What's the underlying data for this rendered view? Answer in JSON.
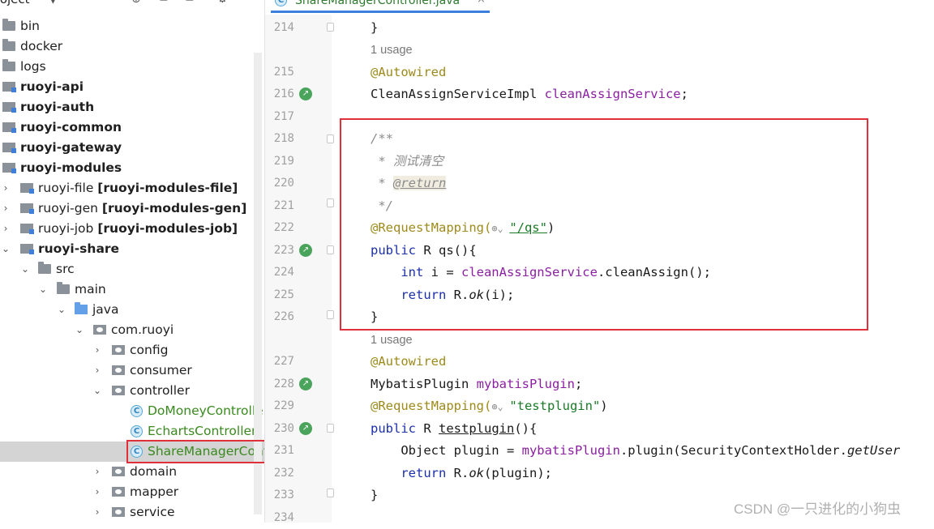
{
  "project_panel": {
    "title": "roject",
    "tree": [
      {
        "label": "bin",
        "bold": false
      },
      {
        "label": "docker",
        "bold": false
      },
      {
        "label": "logs",
        "bold": false
      },
      {
        "label": "ruoyi-api",
        "bold": true
      },
      {
        "label": "ruoyi-auth",
        "bold": true
      },
      {
        "label": "ruoyi-common",
        "bold": true
      },
      {
        "label": "ruoyi-gateway",
        "bold": true
      },
      {
        "label": "ruoyi-modules",
        "bold": true
      },
      {
        "label": "ruoyi-file",
        "suffix": "[ruoyi-modules-file]"
      },
      {
        "label": "ruoyi-gen",
        "suffix": "[ruoyi-modules-gen]"
      },
      {
        "label": "ruoyi-job",
        "suffix": "[ruoyi-modules-job]"
      },
      {
        "label": "ruoyi-share",
        "bold": true
      },
      {
        "label": "src"
      },
      {
        "label": "main"
      },
      {
        "label": "java"
      },
      {
        "label": "com.ruoyi"
      },
      {
        "label": "config"
      },
      {
        "label": "consumer"
      },
      {
        "label": "controller"
      },
      {
        "label": "DoMoneyController"
      },
      {
        "label": "EchartsController"
      },
      {
        "label": "ShareManagerController"
      },
      {
        "label": "domain"
      },
      {
        "label": "mapper"
      },
      {
        "label": "service"
      }
    ]
  },
  "editor": {
    "tab_label": "ShareManagerController.java",
    "tab_close": "×",
    "usage_label": "1 usage",
    "line_numbers": [
      "214",
      "215",
      "216",
      "217",
      "218",
      "219",
      "220",
      "221",
      "222",
      "223",
      "224",
      "225",
      "226",
      "227",
      "228",
      "229",
      "230",
      "231",
      "232",
      "233",
      "234"
    ],
    "code": {
      "l214": "}",
      "l215_ann": "@Autowired",
      "l216_type": "CleanAssignServiceImpl ",
      "l216_field": "cleanAssignService",
      "l216_end": ";",
      "l218": "/**",
      "l219_star": " * ",
      "l219_text": "测试清空",
      "l220_star": " * ",
      "l220_tag": "@return",
      "l221": " */",
      "l222_ann": "@RequestMapping(",
      "l222_str": "\"/qs\"",
      "l222_end": ")",
      "l223_kw": "public ",
      "l223_rest": "R qs(){",
      "l224_kw": "int ",
      "l224_a": "i = ",
      "l224_field": "cleanAssignService",
      "l224_b": ".cleanAssign();",
      "l225_kw": "return ",
      "l225_a": "R.",
      "l225_ok": "ok",
      "l225_b": "(i);",
      "l226": "}",
      "l227_ann": "@Autowired",
      "l228_type": "MybatisPlugin ",
      "l228_field": "mybatisPlugin",
      "l228_end": ";",
      "l229_ann": "@RequestMapping(",
      "l229_str": "\"testplugin\"",
      "l229_end": ")",
      "l230_kw": "public ",
      "l230_a": "R ",
      "l230_name": "testplugin",
      "l230_b": "(){",
      "l231_a": "Object plugin = ",
      "l231_field": "mybatisPlugin",
      "l231_b": ".plugin(SecurityContextHolder.",
      "l231_it": "getUser",
      "l232_kw": "return ",
      "l232_a": "R.",
      "l232_ok": "ok",
      "l232_b": "(plugin);",
      "l233": "}"
    }
  },
  "watermark": "CSDN @一只进化的小狗虫"
}
